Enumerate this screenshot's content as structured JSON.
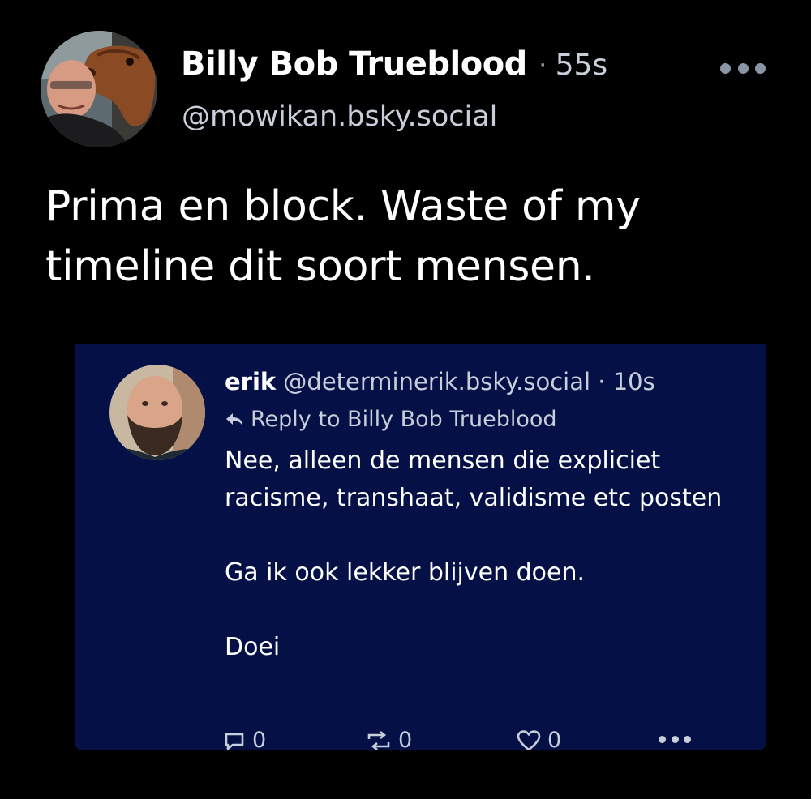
{
  "post": {
    "author_name": "Billy Bob Trueblood",
    "separator": "·",
    "timestamp": "55s",
    "handle": "@mowikan.bsky.social",
    "text": "Prima en block. Waste of my timeline dit soort mensen.",
    "avatar_icon": "user-with-horse-photo",
    "more_icon": "ellipsis-icon"
  },
  "quoted_post": {
    "author_name": "erik",
    "handle": "@determinerik.bsky.social",
    "separator": "·",
    "timestamp": "10s",
    "reply_to": "Reply to Billy Bob Trueblood",
    "body": {
      "para1": "Nee, alleen de mensen die expliciet racisme, transhaat, validisme etc posten",
      "para2": "Ga ik ook lekker blijven doen.",
      "para3": "Doei"
    },
    "avatar_icon": "bearded-user-photo",
    "actions": {
      "replies": "0",
      "reposts": "0",
      "likes": "0"
    }
  },
  "colors": {
    "background": "#000000",
    "quote_background": "#041046",
    "text_primary": "#ffffff",
    "text_secondary": "#c9cfda",
    "icon_muted": "#8b95a8"
  }
}
